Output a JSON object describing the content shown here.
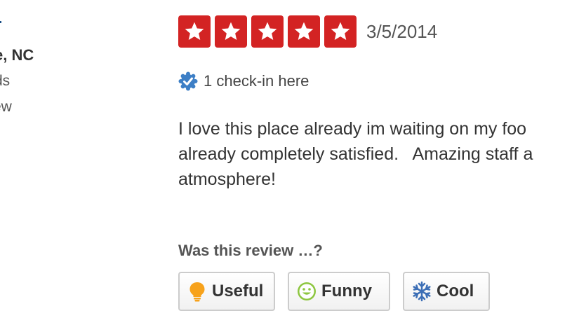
{
  "reviewer": {
    "location_fragment": "e, NC",
    "friends_fragment": "ds",
    "reviews_fragment": "ew"
  },
  "review": {
    "rating": 5,
    "rating_max": 5,
    "date": "3/5/2014",
    "checkin_text": "1 check-in here",
    "text": "I love this place already im waiting on my foo\nalready completely satisfied.   Amazing staff a\natmosphere!"
  },
  "votes": {
    "prompt": "Was this review …?",
    "buttons": [
      {
        "label": "Useful",
        "icon": "lightbulb-icon"
      },
      {
        "label": "Funny",
        "icon": "smiley-icon"
      },
      {
        "label": "Cool",
        "icon": "snowflake-icon"
      }
    ]
  },
  "colors": {
    "star_red": "#d32323",
    "checkin_blue": "#3d7fc6",
    "useful_orange": "#f7a21b",
    "funny_green": "#8dc63f",
    "cool_blue": "#3d6fb6"
  }
}
